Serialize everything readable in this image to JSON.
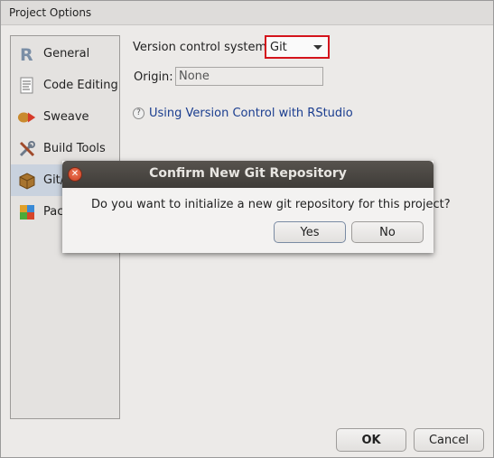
{
  "window": {
    "title": "Project Options"
  },
  "sidebar": {
    "items": [
      {
        "label": "General",
        "icon": "r-logo-icon"
      },
      {
        "label": "Code Editing",
        "icon": "document-icon"
      },
      {
        "label": "Sweave",
        "icon": "sweave-icon"
      },
      {
        "label": "Build Tools",
        "icon": "tools-icon"
      },
      {
        "label": "Git/",
        "icon": "package-box-icon",
        "selected": true
      },
      {
        "label": "Pacl",
        "icon": "packrat-icon"
      }
    ]
  },
  "vcs": {
    "label": "Version control system:",
    "selected": "Git",
    "origin_label": "Origin:",
    "origin_value": "None",
    "help_link": "Using Version Control with RStudio"
  },
  "footer": {
    "ok_label": "OK",
    "cancel_label": "Cancel"
  },
  "dialog": {
    "title": "Confirm New Git Repository",
    "message": "Do you want to initialize a new git repository for this project?",
    "yes_label": "Yes",
    "no_label": "No"
  },
  "colors": {
    "highlight_border": "#d4141c",
    "link": "#1a3d8f",
    "dialog_title_bg": "#4a4641"
  }
}
